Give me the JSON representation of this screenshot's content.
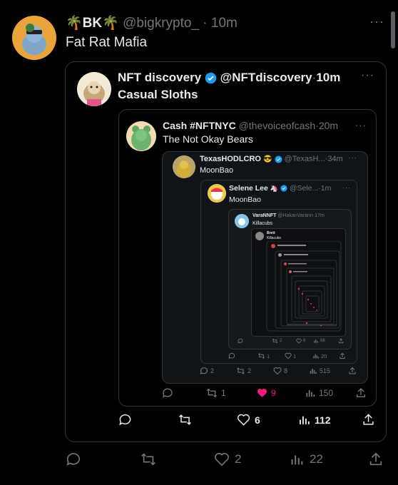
{
  "main": {
    "display_name": "BK",
    "handle": "@bigkrypto_",
    "time": "10m",
    "text": "Fat Rat Mafia",
    "actions": {
      "reply": "",
      "retweet": "",
      "like": "2",
      "views": "22"
    }
  },
  "q1": {
    "display_name": "NFT discovery",
    "handle": "@NFTdiscovery",
    "time": "10m",
    "text": "Casual Sloths",
    "actions": {
      "reply": "",
      "retweet": "",
      "like": "6",
      "views": "112"
    }
  },
  "q2": {
    "display_name": "Cash #NFTNYC",
    "handle": "@thevoiceofcash",
    "time": "20m",
    "text": "The Not Okay Bears",
    "actions": {
      "reply": "",
      "retweet": "1",
      "like": "9",
      "views": "150"
    }
  },
  "q3": {
    "display_name": "TexasHODLCRO",
    "handle": "@TexasH...",
    "time": "34m",
    "text": "MoonBao",
    "actions": {
      "reply": "2",
      "retweet": "2",
      "like": "8",
      "views": "515"
    }
  },
  "q4": {
    "display_name": "Selene Lee",
    "handle": "@Sele...",
    "time": "1m",
    "text": "MoonBao",
    "actions": {
      "reply": "",
      "retweet": "1",
      "like": "1",
      "views": "20"
    }
  },
  "q5": {
    "display_name": "VaraNNFT",
    "handle": "@HakanVarann",
    "time": "17m",
    "text": "Killacubs",
    "actions": {
      "reply": "",
      "retweet": "2",
      "like": "6",
      "views": "68"
    }
  },
  "q6": {
    "display_name": "Brett",
    "text": "Killacubs"
  },
  "colors": {
    "like_active": "#f91880",
    "verified": "#1d9bf0",
    "muted": "#71767b",
    "border": "#2f3336"
  }
}
